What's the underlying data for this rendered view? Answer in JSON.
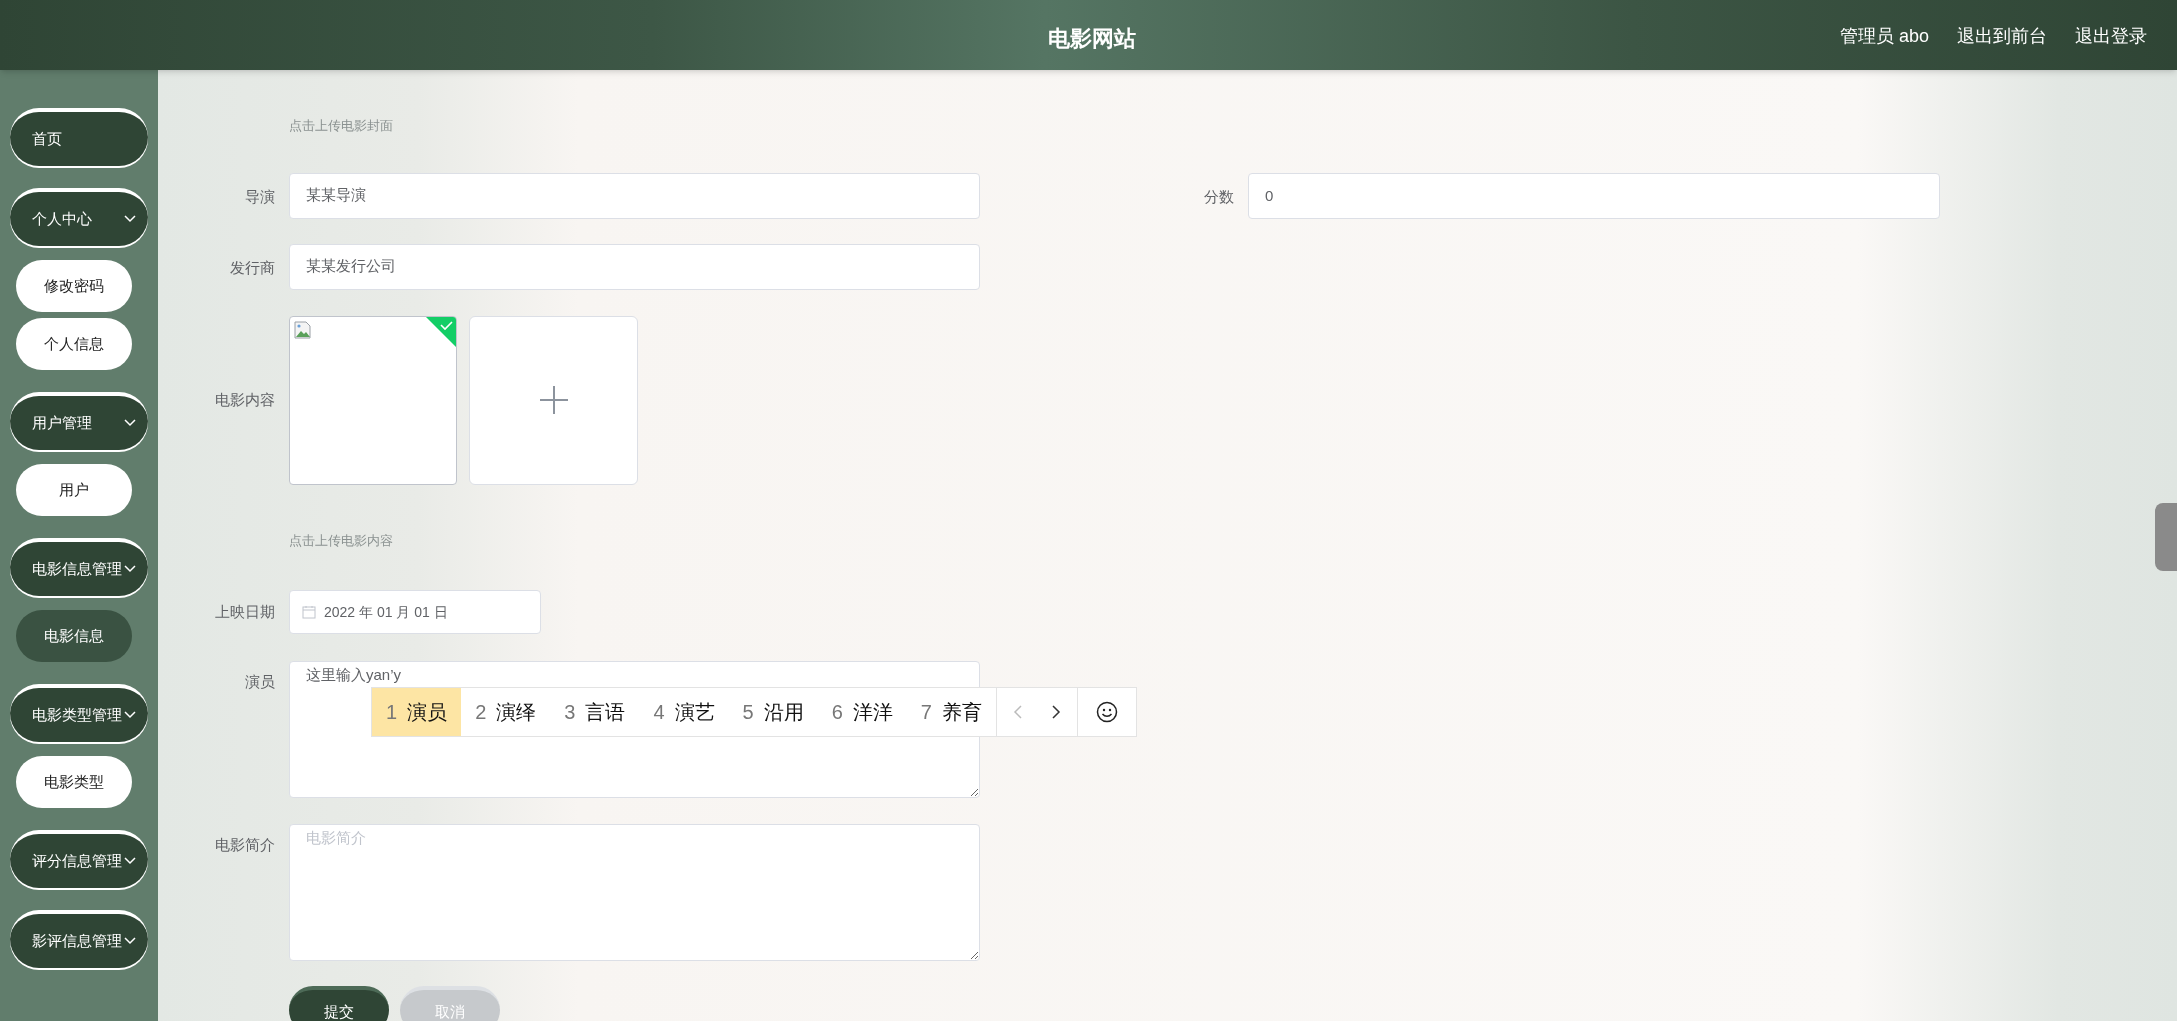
{
  "header": {
    "title": "电影网站",
    "links": [
      "管理员 abo",
      "退出到前台",
      "退出登录"
    ]
  },
  "sidebar": {
    "items": [
      {
        "kind": "link",
        "label": "首页"
      },
      {
        "kind": "group",
        "label": "个人中心",
        "children": [
          {
            "label": "修改密码",
            "selected": false
          },
          {
            "label": "个人信息",
            "selected": false
          }
        ]
      },
      {
        "kind": "group",
        "label": "用户管理",
        "children": [
          {
            "label": "用户",
            "selected": false
          }
        ]
      },
      {
        "kind": "group",
        "label": "电影信息管理",
        "children": [
          {
            "label": "电影信息",
            "selected": true
          }
        ]
      },
      {
        "kind": "group",
        "label": "电影类型管理",
        "children": [
          {
            "label": "电影类型",
            "selected": false
          }
        ]
      },
      {
        "kind": "group",
        "label": "评分信息管理"
      },
      {
        "kind": "group",
        "label": "影评信息管理"
      }
    ]
  },
  "form": {
    "cover_hint": "点击上传电影封面",
    "director": {
      "label": "导演",
      "value": "某某导演"
    },
    "score": {
      "label": "分数",
      "value": "0"
    },
    "publisher": {
      "label": "发行商",
      "value": "某某发行公司"
    },
    "content_upload": {
      "label": "电影内容",
      "files": [
        {
          "uploaded": true
        }
      ],
      "hint": "点击上传电影内容"
    },
    "release_date": {
      "label": "上映日期",
      "value": "2022 年 01 月 01 日"
    },
    "actors": {
      "label": "演员",
      "value": "这里输入yan’y"
    },
    "intro": {
      "label": "电影简介",
      "placeholder": "电影简介"
    },
    "buttons": [
      {
        "label": "提交",
        "kind": "primary"
      },
      {
        "label": "取消",
        "kind": "secondary"
      }
    ]
  },
  "ime": {
    "candidates": [
      {
        "number": "1",
        "word": "演员",
        "selected": true
      },
      {
        "number": "2",
        "word": "演绎",
        "selected": false
      },
      {
        "number": "3",
        "word": "言语",
        "selected": false
      },
      {
        "number": "4",
        "word": "演艺",
        "selected": false
      },
      {
        "number": "5",
        "word": "沿用",
        "selected": false
      },
      {
        "number": "6",
        "word": "洋洋",
        "selected": false
      },
      {
        "number": "7",
        "word": "养育",
        "selected": false
      }
    ]
  }
}
